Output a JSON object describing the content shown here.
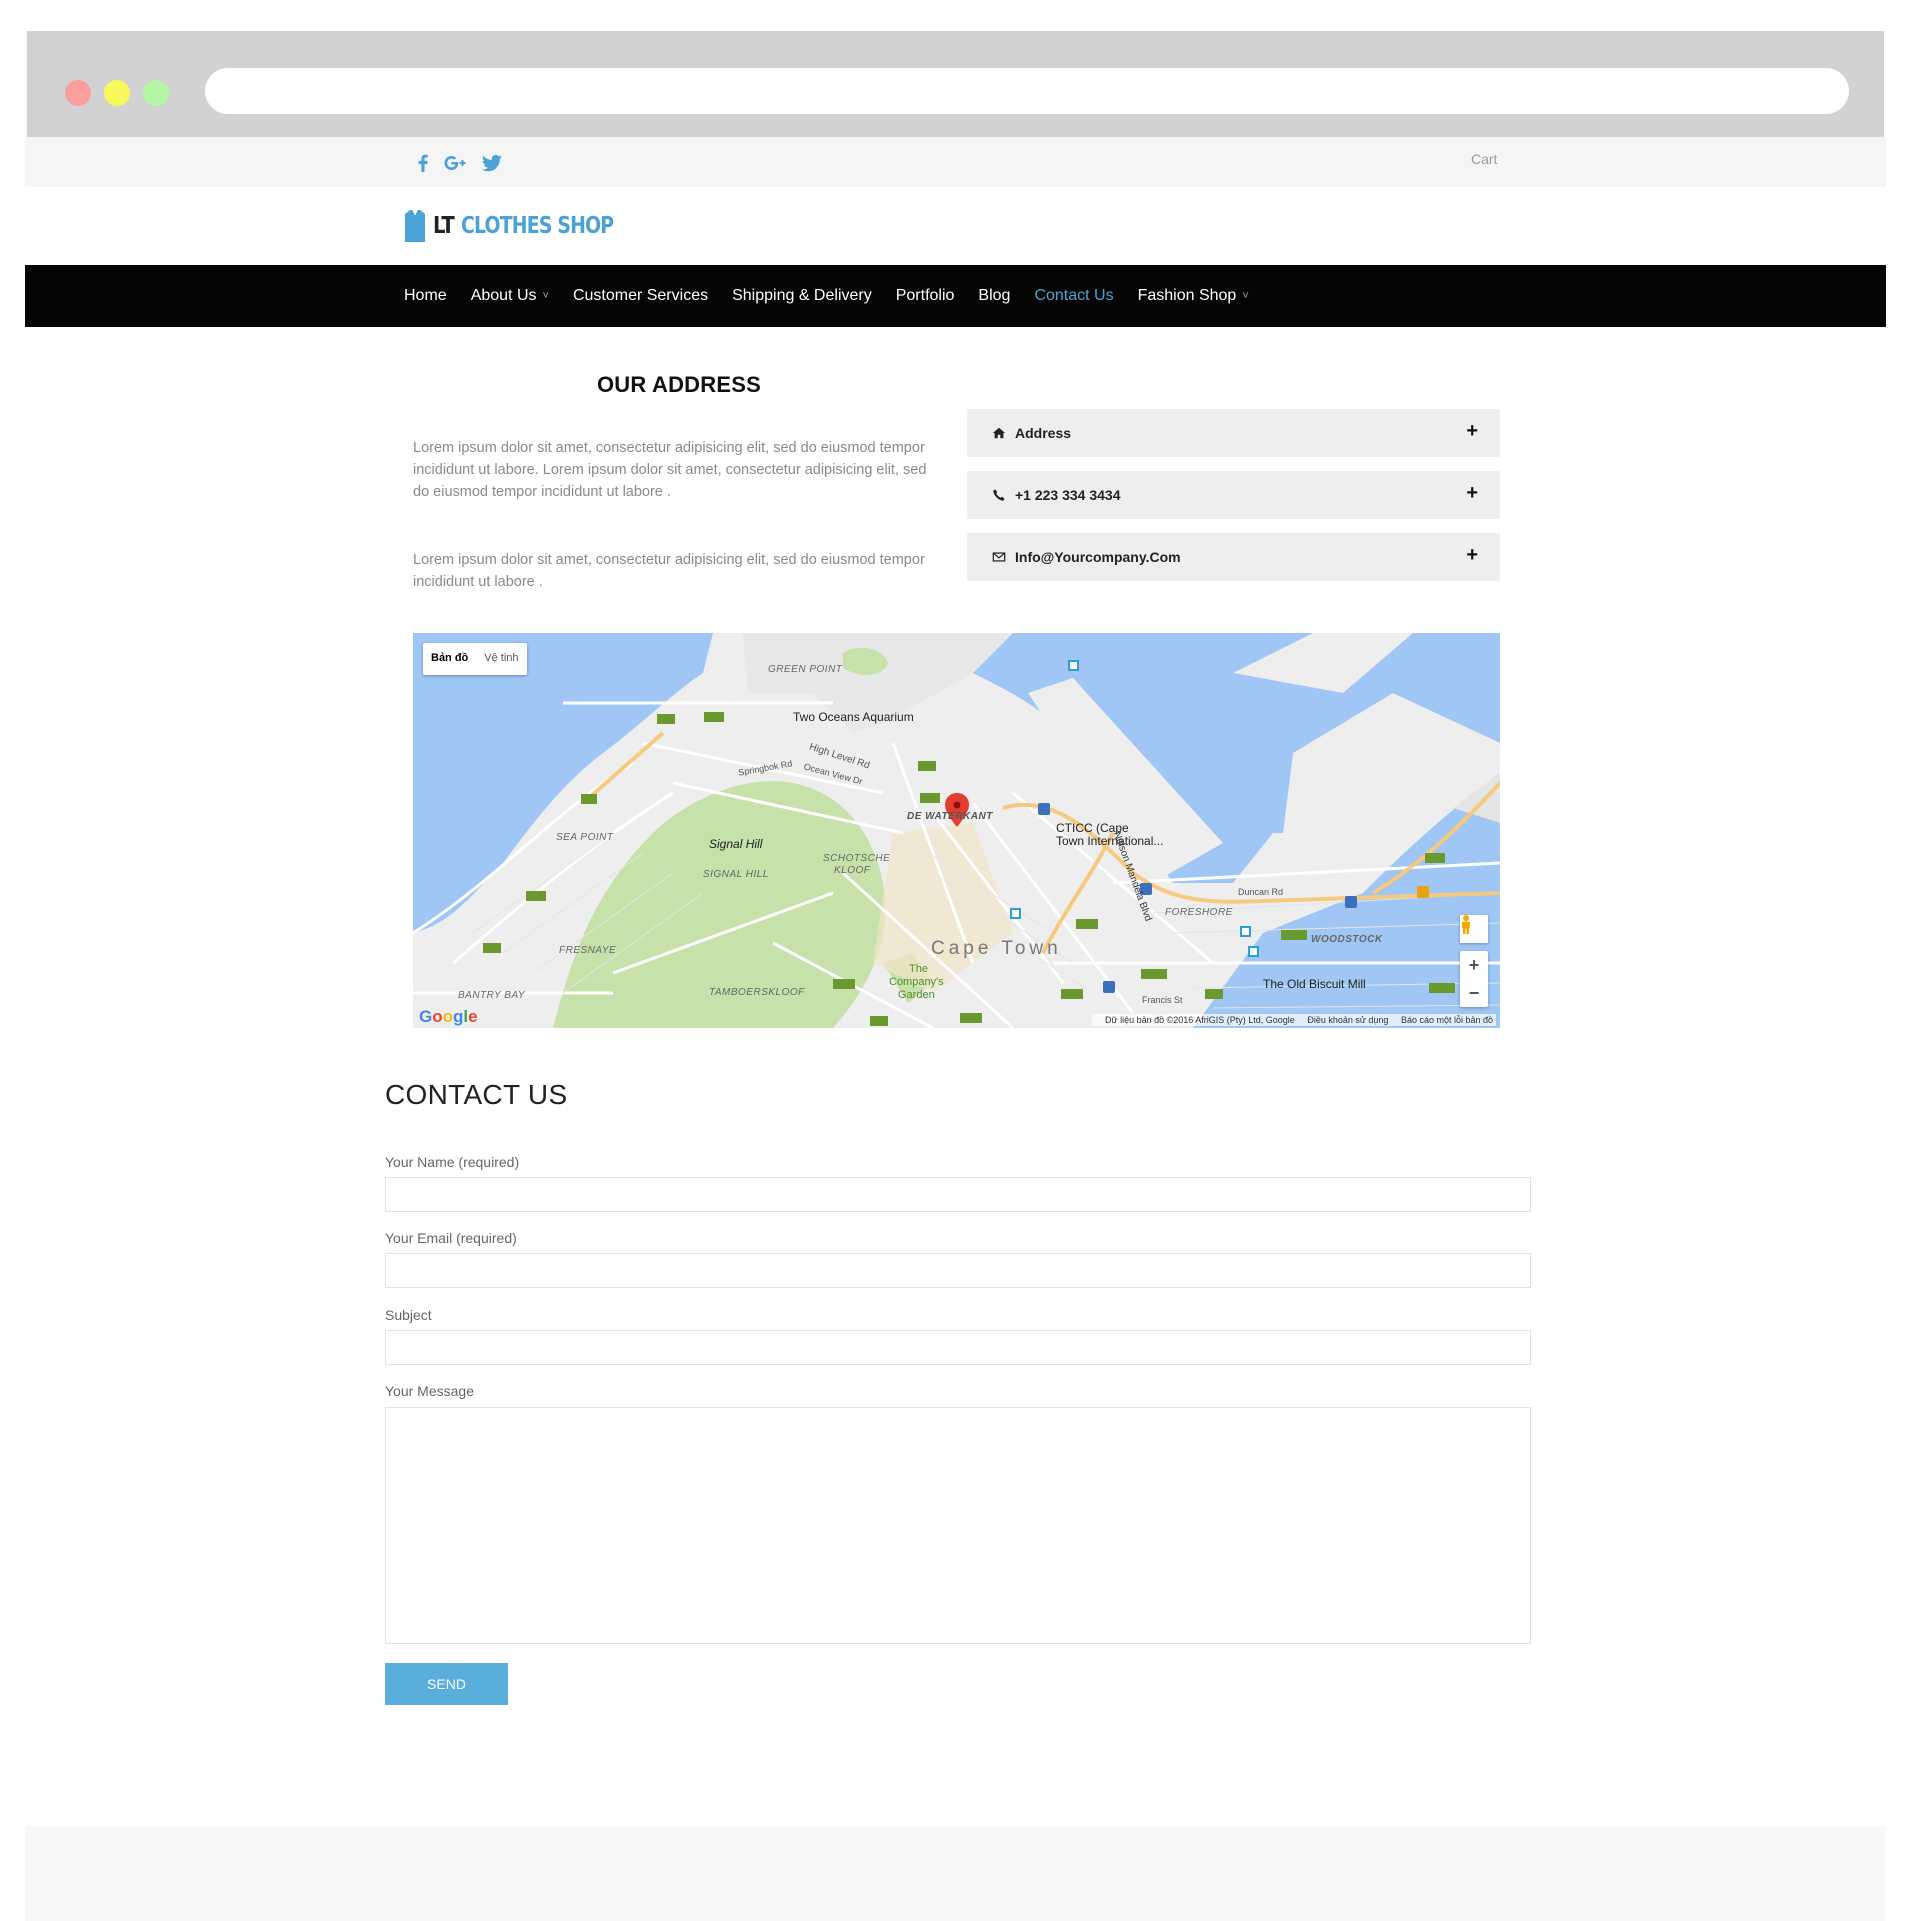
{
  "browser": {
    "address_value": ""
  },
  "topbar": {
    "social": [
      "facebook-icon",
      "google-plus-icon",
      "twitter-icon"
    ],
    "cart": "Cart"
  },
  "logo": {
    "prefix": "LT",
    "name": "CLOTHES SHOP"
  },
  "nav": {
    "items": [
      {
        "label": "Home",
        "dropdown": false,
        "active": false
      },
      {
        "label": "About Us",
        "dropdown": true,
        "active": false
      },
      {
        "label": "Customer Services",
        "dropdown": false,
        "active": false
      },
      {
        "label": "Shipping & Delivery",
        "dropdown": false,
        "active": false
      },
      {
        "label": "Portfolio",
        "dropdown": false,
        "active": false
      },
      {
        "label": "Blog",
        "dropdown": false,
        "active": false
      },
      {
        "label": "Contact Us",
        "dropdown": false,
        "active": true
      },
      {
        "label": "Fashion Shop",
        "dropdown": true,
        "active": false
      }
    ]
  },
  "address": {
    "title": "OUR ADDRESS",
    "paragraphs": [
      "Lorem ipsum dolor sit amet, consectetur adipisicing elit, sed do eiusmod tempor incididunt ut labore. Lorem ipsum dolor sit amet, consectetur adipisicing elit, sed do eiusmod tempor incididunt ut labore .",
      "Lorem ipsum dolor sit amet, consectetur adipisicing elit, sed do eiusmod tempor incididunt ut labore ."
    ],
    "accordion": [
      {
        "icon": "home-icon",
        "label": "Address"
      },
      {
        "icon": "phone-icon",
        "label": "+1 223 334 3434"
      },
      {
        "icon": "envelope-icon",
        "label": "Info@Yourcompany.Com"
      }
    ],
    "expand_glyph": "+"
  },
  "map": {
    "type_options": [
      "Bản đồ",
      "Vệ tinh"
    ],
    "selected_type": "Bản đồ",
    "labels": {
      "green_point": "GREEN POINT",
      "two_oceans": "Two Oceans Aquarium",
      "high_level": "High Level Rd",
      "springbok": "Springbok Rd",
      "ocean_view": "Ocean View Dr",
      "de_waterkant": "DE WATERKANT",
      "ctcc_1": "CTICC (Cape",
      "ctcc_2": "Town International...",
      "sea_point": "SEA POINT",
      "signal_hill": "Signal Hill",
      "signal_hill_area": "SIGNAL HILL",
      "schotsche_1": "SCHOTSCHE",
      "schotsche_2": "KLOOF",
      "foreshore": "FORESHORE",
      "woodstock": "WOODSTOCK",
      "cape_town": "Cape Town",
      "fresnaye": "FRESNAYE",
      "company_1": "The",
      "company_2": "Company's",
      "company_3": "Garden",
      "biscuit": "The Old Biscuit Mill",
      "bantry": "BANTRY BAY",
      "tamboers": "TAMBOERSKLOOF",
      "nelson": "Nelson Mandela Blvd",
      "duncan": "Duncan Rd",
      "francis": "Francis St"
    },
    "zoom_in": "+",
    "zoom_out": "−",
    "google": "Google",
    "credits": [
      "Dữ liệu bản đồ ©2016 AfriGIS (Pty) Ltd, Google",
      "Điều khoản sử dụng",
      "Báo cáo một lỗi bản đồ"
    ]
  },
  "contact": {
    "title": "CONTACT US",
    "fields": [
      {
        "label": "Your Name (required)",
        "value": ""
      },
      {
        "label": "Your Email (required)",
        "value": ""
      },
      {
        "label": "Subject",
        "value": ""
      }
    ],
    "message_label": "Your Message",
    "message_value": "",
    "send": "SEND"
  },
  "colors": {
    "accent": "#4aa3d4",
    "nav_bg": "#050505",
    "button": "#5aaedc"
  }
}
